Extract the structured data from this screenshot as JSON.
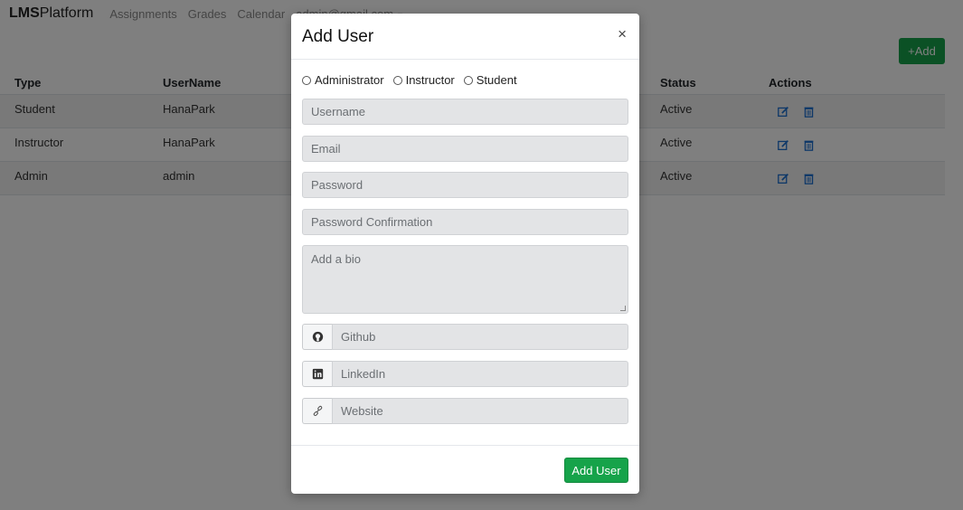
{
  "navbar": {
    "brand_bold": "LMS",
    "brand_rest": "Platform",
    "links": [
      "Assignments",
      "Grades",
      "Calendar"
    ],
    "user": "admin@gmail.com"
  },
  "page": {
    "add_label": "+Add"
  },
  "table": {
    "headers": {
      "type": "Type",
      "username": "UserName",
      "status": "Status",
      "actions": "Actions"
    },
    "rows": [
      {
        "type": "Student",
        "username": "HanaPark",
        "status": "Active"
      },
      {
        "type": "Instructor",
        "username": "HanaPark",
        "status": "Active"
      },
      {
        "type": "Admin",
        "username": "admin",
        "status": "Active"
      }
    ]
  },
  "modal": {
    "title": "Add User",
    "close": "×",
    "roles": [
      "Administrator",
      "Instructor",
      "Student"
    ],
    "placeholders": {
      "username": "Username",
      "email": "Email",
      "password": "Password",
      "password_confirmation": "Password Confirmation",
      "bio": "Add a bio",
      "github": "Github",
      "linkedin": "LinkedIn",
      "website": "Website"
    },
    "submit": "Add User"
  },
  "colors": {
    "accent_green": "#16a34a",
    "action_blue": "#1a6fd1",
    "overlay": "rgba(0,0,0,0.5)"
  },
  "icons": {
    "github": "github-icon",
    "linkedin": "linkedin-icon",
    "website": "link-icon",
    "edit": "edit-icon",
    "delete": "trash-icon"
  }
}
